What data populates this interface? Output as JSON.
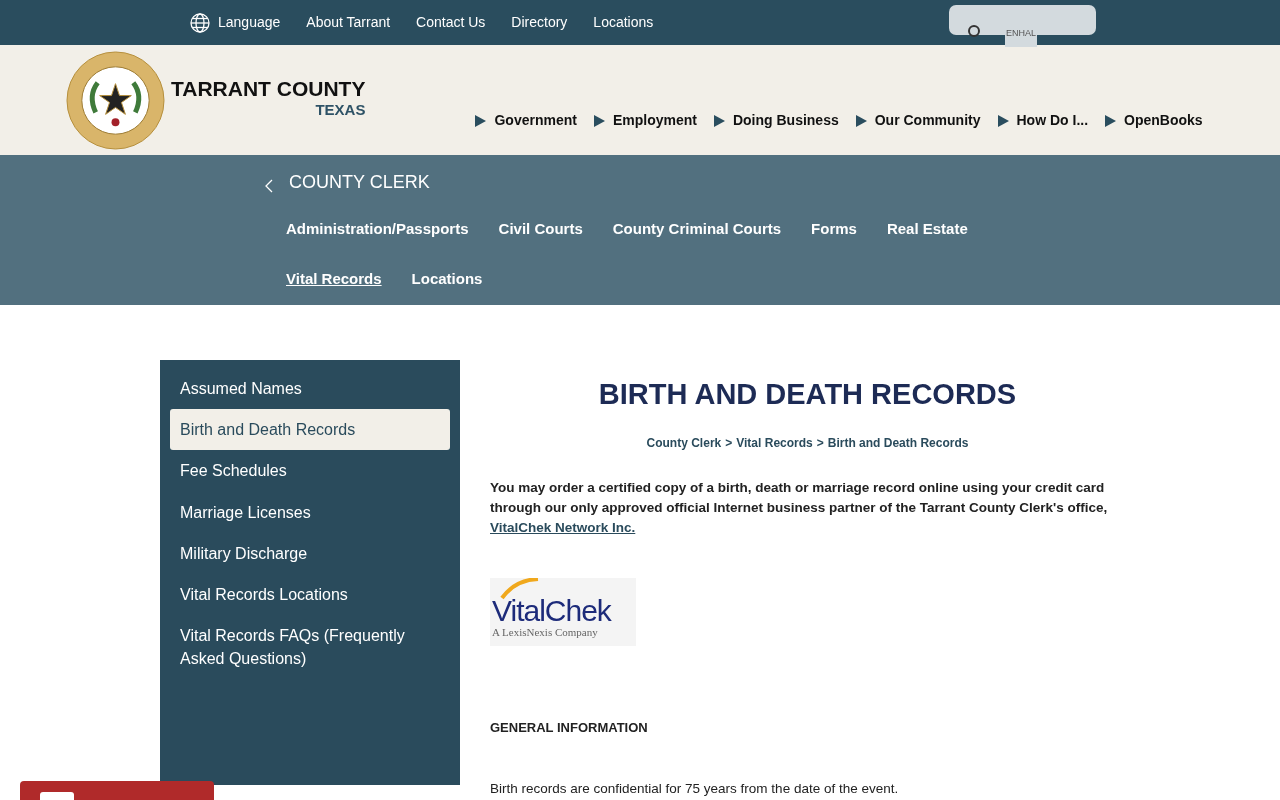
{
  "top_bar": {
    "language": "Language",
    "links": [
      "About Tarrant",
      "Contact Us",
      "Directory",
      "Locations"
    ],
    "search_overlay": "ENHAL"
  },
  "header": {
    "title": "TARRANT COUNTY",
    "subtitle": "TEXAS",
    "nav": [
      "Government",
      "Employment",
      "Doing Business",
      "Our Community",
      "How Do I...",
      "OpenBooks"
    ]
  },
  "department": {
    "title": "COUNTY CLERK",
    "links": [
      {
        "label": "Administration/Passports",
        "selected": false
      },
      {
        "label": "Civil Courts",
        "selected": false
      },
      {
        "label": "County Criminal Courts",
        "selected": false
      },
      {
        "label": "Forms",
        "selected": false
      },
      {
        "label": "Real Estate",
        "selected": false
      },
      {
        "label": "Vital Records",
        "selected": true
      },
      {
        "label": "Locations",
        "selected": false
      }
    ]
  },
  "sidebar": {
    "items": [
      {
        "label": "Assumed Names",
        "selected": false
      },
      {
        "label": "Birth and Death Records",
        "selected": true
      },
      {
        "label": "Fee Schedules",
        "selected": false
      },
      {
        "label": "Marriage Licenses",
        "selected": false
      },
      {
        "label": "Military Discharge",
        "selected": false
      },
      {
        "label": "Vital Records Locations",
        "selected": false
      },
      {
        "label": "Vital Records FAQs (Frequently Asked Questions)",
        "selected": false
      }
    ]
  },
  "content": {
    "title": "BIRTH AND DEATH RECORDS",
    "breadcrumb": [
      "County Clerk",
      "Vital Records",
      "Birth and Death Records"
    ],
    "breadcrumb_separator": ">",
    "intro": "You may order a certified copy of a birth, death or marriage record online using your credit card through our only approved official Internet business partner of the Tarrant County Clerk's office, ",
    "intro_link": "VitalChek Network Inc.",
    "logo": {
      "name": "VitalChek",
      "tagline": "A LexisNexis Company"
    },
    "section_heading": "GENERAL INFORMATION",
    "paragraph": "Birth records are confidential for 75 years from the date of the event."
  }
}
